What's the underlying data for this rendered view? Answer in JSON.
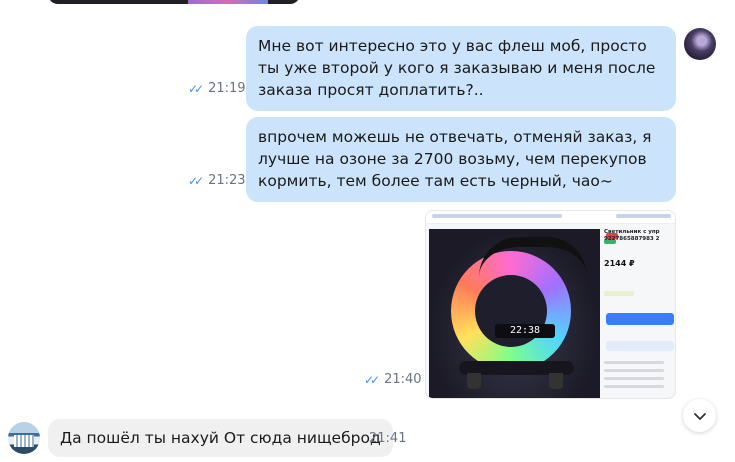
{
  "messages": [
    {
      "direction": "outgoing",
      "text": "Мне вот интересно это у вас флеш моб, просто ты уже второй у кого я заказываю и меня после заказа просят доплатить?..",
      "time": "21:19",
      "status_icon": "double-check-icon"
    },
    {
      "direction": "outgoing",
      "text": "впрочем можешь не отвечать, отменяй заказ, я лучше на озоне за 2700 возьму, чем перекупов кормить, тем более там есть черный, чао~",
      "time": "21:23",
      "status_icon": "double-check-icon"
    },
    {
      "direction": "outgoing",
      "type": "image",
      "time": "21:40",
      "status_icon": "double-check-icon",
      "image": {
        "clock_readout": "22:38",
        "product_title": "Светильник с упр",
        "product_code": "9227865887983 2",
        "price": "2144 ₽"
      }
    },
    {
      "direction": "incoming",
      "text": "Да пошёл ты нахуй От сюда нищеброд",
      "time": "21:41"
    }
  ],
  "controls": {
    "scroll_down_icon": "chevron-down-icon"
  },
  "colors": {
    "outgoing_bubble": "#cce4fb",
    "incoming_bubble": "#f0f0f0",
    "check_color": "#4a90e2",
    "time_color": "#6b7280"
  }
}
